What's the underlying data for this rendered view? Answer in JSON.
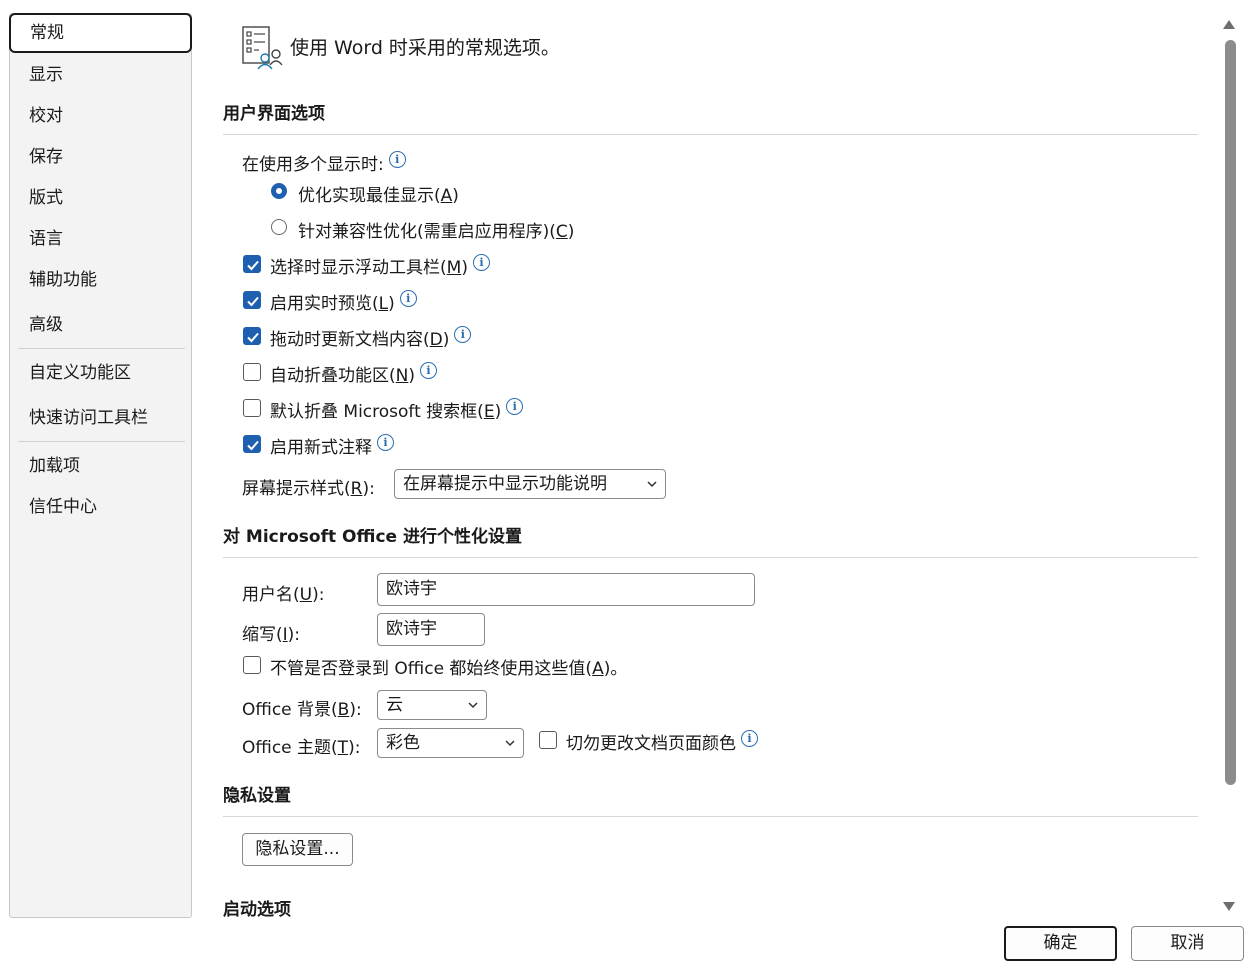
{
  "sidebar": {
    "items": [
      {
        "label": "常规"
      },
      {
        "label": "显示"
      },
      {
        "label": "校对"
      },
      {
        "label": "保存"
      },
      {
        "label": "版式"
      },
      {
        "label": "语言"
      },
      {
        "label": "辅助功能"
      },
      {
        "label": "高级"
      },
      {
        "label": "自定义功能区"
      },
      {
        "label": "快速访问工具栏"
      },
      {
        "label": "加载项"
      },
      {
        "label": "信任中心"
      }
    ],
    "selected": "常规"
  },
  "header": {
    "text": "使用 Word 时采用的常规选项。",
    "icon": "general-options-icon"
  },
  "ui_section": {
    "title": "用户界面选项",
    "multi_display_label": "在使用多个显示时:",
    "radio_optimize": {
      "text": "优化实现最佳显示(",
      "key": "A",
      "end": ")",
      "checked": true
    },
    "radio_compat": {
      "text": "针对兼容性优化(需重启应用程序)(",
      "key": "C",
      "end": ")",
      "checked": false
    },
    "cb_minitoolbar": {
      "text": "选择时显示浮动工具栏(",
      "key": "M",
      "end": ")",
      "checked": true
    },
    "cb_livepreview": {
      "text": "启用实时预览(",
      "key": "L",
      "end": ")",
      "checked": true
    },
    "cb_dragupdate": {
      "text": "拖动时更新文档内容(",
      "key": "D",
      "end": ")",
      "checked": true
    },
    "cb_collapseribbon": {
      "text": "自动折叠功能区(",
      "key": "N",
      "end": ")",
      "checked": false
    },
    "cb_collapsesearch": {
      "text": "默认折叠 Microsoft 搜索框(",
      "key": "E",
      "end": ")",
      "checked": false
    },
    "cb_modernComments": {
      "text": "启用新式注释",
      "checked": true
    },
    "screentip_label": {
      "text": "屏幕提示样式(",
      "key": "R",
      "end": "):"
    },
    "screentip_value": "在屏幕提示中显示功能说明"
  },
  "personal_section": {
    "title": "对 Microsoft Office 进行个性化设置",
    "username_label": {
      "text": "用户名(",
      "key": "U",
      "end": "):"
    },
    "username_value": "欧诗宇",
    "initials_label": {
      "text": "缩写(",
      "key": "I",
      "end": "):"
    },
    "initials_value": "欧诗宇",
    "cb_always_use": {
      "text": "不管是否登录到 Office 都始终使用这些值(",
      "key": "A",
      "end": ")。",
      "checked": false
    },
    "background_label": {
      "text": "Office 背景(",
      "key": "B",
      "end": "):"
    },
    "background_value": "云",
    "theme_label": {
      "text": "Office 主题(",
      "key": "T",
      "end": "):"
    },
    "theme_value": "彩色",
    "cb_never_change_page_color": {
      "text": "切勿更改文档页面颜色",
      "checked": false
    }
  },
  "privacy_section": {
    "title": "隐私设置",
    "button": "隐私设置..."
  },
  "startup_section": {
    "title": "启动选项"
  },
  "footer": {
    "ok": "确定",
    "cancel": "取消"
  },
  "colors": {
    "accent": "#1f5fb0",
    "info": "#2b6cb0"
  }
}
